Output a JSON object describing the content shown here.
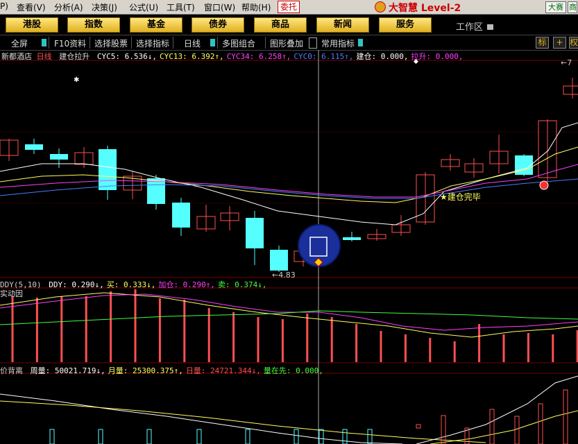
{
  "menu": {
    "items": [
      "P)",
      "查看(V)",
      "分析(A)",
      "决策(J)",
      "公式(U)",
      "工具(T)",
      "窗口(W)",
      "帮助(H)"
    ],
    "entrust": "委托",
    "logo": "大智慧 Level-2",
    "right_buttons": [
      "大赛",
      "商"
    ]
  },
  "nav": {
    "buttons": [
      "港股",
      "指数",
      "基金",
      "债券",
      "商品",
      "新闻",
      "服务"
    ],
    "workspace": "工作区"
  },
  "toolbar": {
    "items": [
      "全屏",
      "F10资料",
      "选择股票",
      "选择指标",
      "日线",
      "多图组合",
      "图形叠加",
      "常用指标"
    ],
    "right": [
      "标",
      "+",
      "权"
    ]
  },
  "main_chart": {
    "stock_name": "新都酒店",
    "period": "日线",
    "indicator": "建仓拉升",
    "values": [
      {
        "label": "CYC5: 6.536",
        "arrow": "↓",
        "color": "#ffffff"
      },
      {
        "label": "CYC13: 6.392",
        "arrow": "↑",
        "color": "#ffff60"
      },
      {
        "label": "CYC34: 6.258",
        "arrow": "↑",
        "color": "#ff40ff"
      },
      {
        "label": "CYC0: 6.115",
        "arrow": "↑",
        "color": "#4a7cff"
      },
      {
        "label": "建仓: 0.000,",
        "arrow": "",
        "color": "#ffffff"
      },
      {
        "label": "拉升: 0.000,",
        "arrow": "",
        "color": "#ff40ff"
      }
    ],
    "annotations": {
      "build_done": "★建仓完毕",
      "low": "4.83",
      "high": "7"
    }
  },
  "ddy_panel": {
    "name": "DDY(5,10)",
    "values": [
      {
        "label": "DDY: 0.290",
        "arrow": "↓",
        "color": "#ffffff"
      },
      {
        "label": "买: 0.333",
        "arrow": "↓",
        "color": "#ffff60"
      },
      {
        "label": "加仓: 0.290",
        "arrow": "↑",
        "color": "#ff40ff"
      },
      {
        "label": "卖: 0.374",
        "arrow": "↓",
        "color": "#40ff40"
      }
    ],
    "sub_label": "实动因"
  },
  "vol_panel": {
    "name": "价背离",
    "values": [
      {
        "label": "周量: 50021.719",
        "arrow": "↓",
        "color": "#ffffff"
      },
      {
        "label": "月量: 25300.375",
        "arrow": "↑",
        "color": "#ffff60"
      },
      {
        "label": "日量: 24721.344",
        "arrow": "↓",
        "color": "#ff5050"
      },
      {
        "label": "量在先: 0.000,",
        "arrow": "",
        "color": "#40ff40"
      }
    ]
  }
}
